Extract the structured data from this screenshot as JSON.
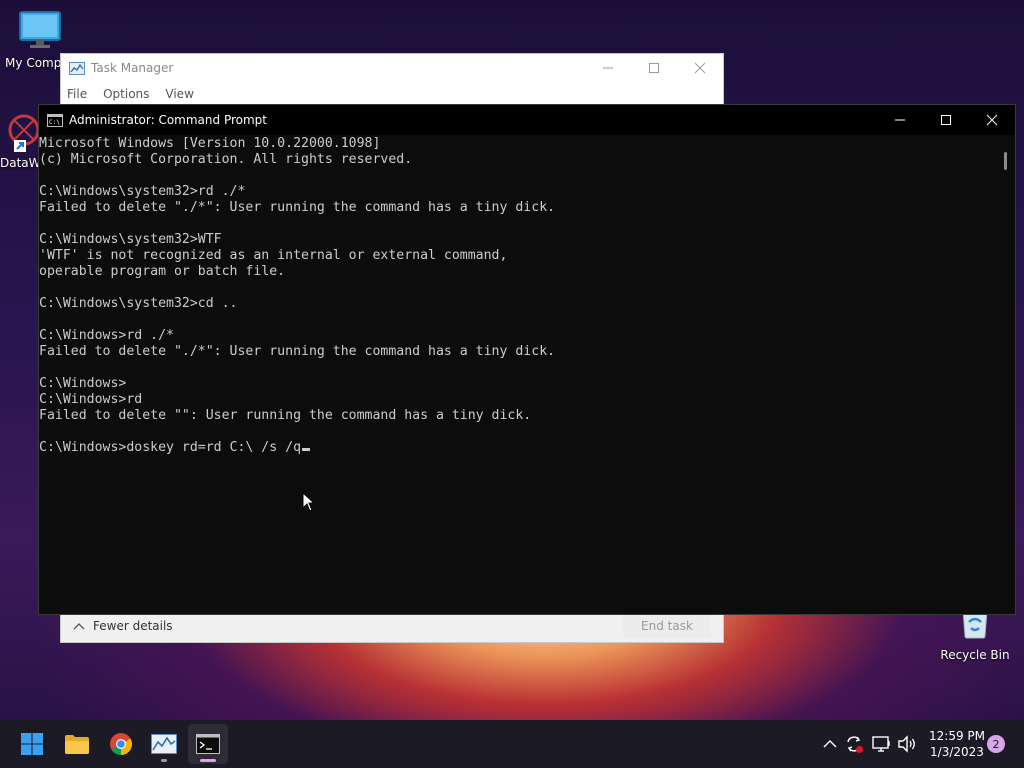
{
  "desktop": {
    "icons": [
      {
        "label": "My Compu"
      },
      {
        "label": "DataW"
      },
      {
        "label": "Recycle Bin"
      }
    ]
  },
  "task_manager": {
    "title": "Task Manager",
    "menu": [
      "File",
      "Options",
      "View"
    ],
    "fewer_details": "Fewer details",
    "end_task": "End task"
  },
  "cmd": {
    "title": "Administrator: Command Prompt",
    "lines": [
      "Microsoft Windows [Version 10.0.22000.1098]",
      "(c) Microsoft Corporation. All rights reserved.",
      "",
      "C:\\Windows\\system32>rd ./*",
      "Failed to delete \"./*\": User running the command has a tiny dick.",
      "",
      "C:\\Windows\\system32>WTF",
      "'WTF' is not recognized as an internal or external command,",
      "operable program or batch file.",
      "",
      "C:\\Windows\\system32>cd ..",
      "",
      "C:\\Windows>rd ./*",
      "Failed to delete \"./*\": User running the command has a tiny dick.",
      "",
      "C:\\Windows>",
      "C:\\Windows>rd",
      "Failed to delete \"\": User running the command has a tiny dick.",
      "",
      "C:\\Windows>doskey rd=rd C:\\ /s /q"
    ]
  },
  "taskbar": {
    "apps": [
      "start-icon",
      "file-explorer-icon",
      "chrome-icon",
      "task-manager-icon",
      "terminal-icon"
    ],
    "clock_time": "12:59 PM",
    "clock_date": "1/3/2023",
    "notification_count": "2"
  },
  "colors": {
    "console_bg": "#0c0c0c",
    "console_text": "#cccccc",
    "taskbar_bg": "#1c1a24",
    "active_indicator": "#d7a6e8"
  }
}
